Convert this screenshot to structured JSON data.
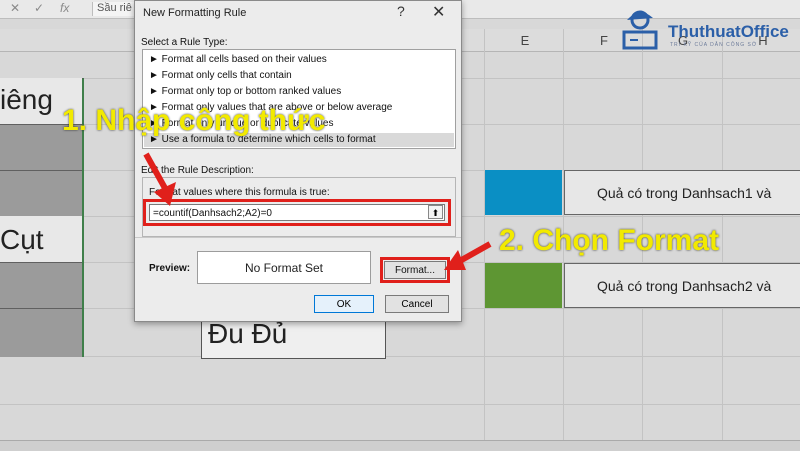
{
  "formula_bar": {
    "fx": "fx",
    "content": "Sầu riê"
  },
  "columns": {
    "E": "E",
    "F": "F",
    "G": "G",
    "H": "H"
  },
  "cells": {
    "col_a_row1": "iêng",
    "col_a_row2": "Cụt",
    "dudu": "Đu Đủ",
    "fruit_row1": "Quả có trong Danhsach1 và",
    "fruit_row2": "Quả có trong Danhsach2 và"
  },
  "dialog": {
    "title": "New Formatting Rule",
    "help": "?",
    "close": "✕",
    "select_rule_type_label": "Select a Rule Type:",
    "rule_types": [
      "► Format all cells based on their values",
      "► Format only cells that contain",
      "► Format only top or bottom ranked values",
      "► Format only values that are above or below average",
      "► Format only unique or duplicate values",
      "► Use a formula to determine which cells to format"
    ],
    "edit_description_label": "Edit the Rule Description:",
    "formula_label": "Format values where this formula is true:",
    "formula_value": "=countif(Danhsach2;A2)=0",
    "preview_label": "Preview:",
    "preview_text": "No Format Set",
    "format_button": "Format...",
    "ok_button": "OK",
    "cancel_button": "Cancel"
  },
  "annotations": {
    "step1": "1. Nhập công thức",
    "step2": "2. Chọn Format"
  },
  "logo": {
    "name": "ThuthuatOffice",
    "tagline": "TRI KỸ CỦA DÂN CÔNG SỞ"
  },
  "colors": {
    "annotation_yellow": "#f2ea00",
    "highlight_red": "#e0201b",
    "blue_fill": "#0a8fc4",
    "green_fill": "#5e9633",
    "logo_blue": "#2b5fa8"
  }
}
